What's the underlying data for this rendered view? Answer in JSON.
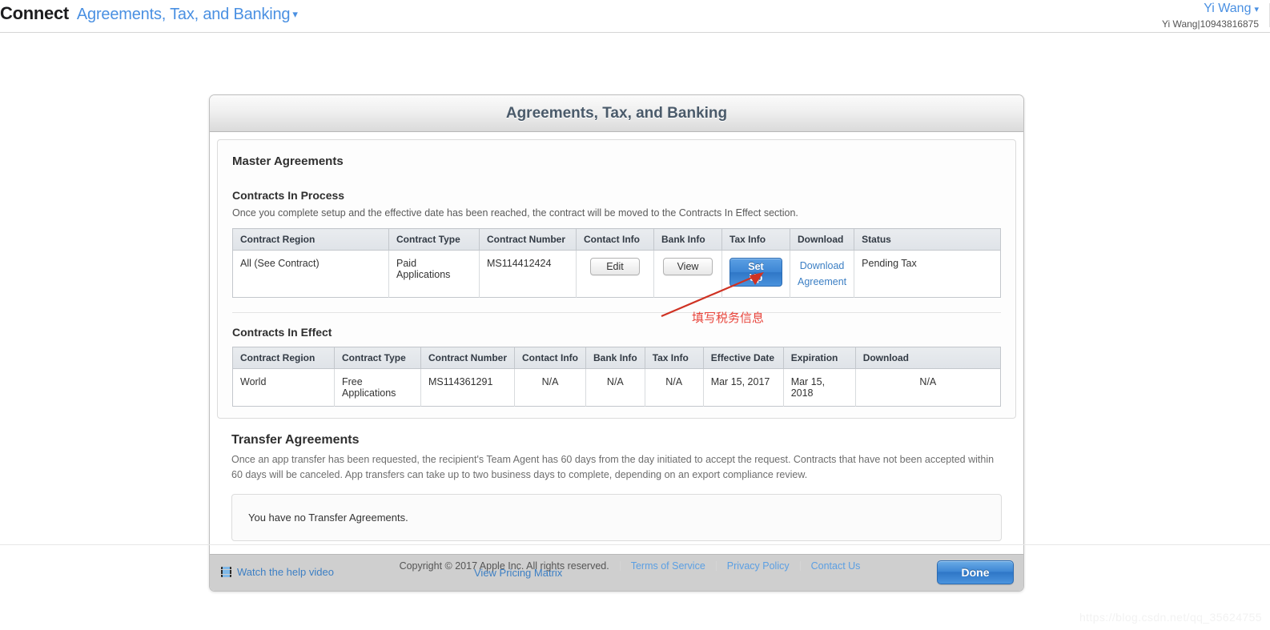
{
  "topnav": {
    "brand": "Connect",
    "section": "Agreements, Tax, and Banking",
    "section_caret": "chevron-down",
    "user_name": "Yi Wang",
    "user_caret": "chevron-down",
    "user_sub": "Yi Wang|10943816875"
  },
  "card": {
    "title": "Agreements, Tax, and Banking"
  },
  "master": {
    "heading": "Master Agreements",
    "in_process": {
      "heading": "Contracts In Process",
      "description": "Once you complete setup and the effective date has been reached, the contract will be moved to the Contracts In Effect section.",
      "columns": [
        "Contract Region",
        "Contract Type",
        "Contract Number",
        "Contact Info",
        "Bank Info",
        "Tax Info",
        "Download",
        "Status"
      ],
      "rows": [
        {
          "region": "All (See Contract)",
          "type": "Paid Applications",
          "number": "MS114412424",
          "contact_button": "Edit",
          "bank_button": "View",
          "tax_button": "Set Up",
          "download_line1": "Download",
          "download_line2": "Agreement",
          "status": "Pending Tax"
        }
      ]
    },
    "in_effect": {
      "heading": "Contracts In Effect",
      "columns": [
        "Contract Region",
        "Contract Type",
        "Contract Number",
        "Contact Info",
        "Bank Info",
        "Tax Info",
        "Effective Date",
        "Expiration",
        "Download"
      ],
      "rows": [
        {
          "region": "World",
          "type": "Free Applications",
          "number": "MS114361291",
          "contact": "N/A",
          "bank": "N/A",
          "tax": "N/A",
          "effective": "Mar 15, 2017",
          "expiration": "Mar 15, 2018",
          "download": "N/A"
        }
      ]
    }
  },
  "transfer": {
    "heading": "Transfer Agreements",
    "description": "Once an app transfer has been requested, the recipient's Team Agent has 60 days from the day initiated to accept the request. Contracts that have not been accepted within 60 days will be canceled. App transfers can take up to two business days to complete, depending on an export compliance review.",
    "empty_message": "You have no Transfer Agreements."
  },
  "card_footer": {
    "help_video": "Watch the help video",
    "help_video_icon": "film-strip-icon",
    "pricing_matrix": "View Pricing Matrix",
    "done_button": "Done"
  },
  "site_footer": {
    "copyright": "Copyright © 2017 Apple Inc. All rights reserved.",
    "links": [
      "Terms of Service",
      "Privacy Policy",
      "Contact Us"
    ]
  },
  "annotation": {
    "text": "填写税务信息",
    "color": "#e8453c"
  },
  "watermark": {
    "text": "https://blog.csdn.net/qq_35624755"
  },
  "colors": {
    "link_blue": "#4a90e2",
    "button_blue": "#3d86d4",
    "card_header_text": "#4a5a6a",
    "table_header_bg": "#e4e8ec",
    "footer_bar": "#cfcfcf"
  }
}
